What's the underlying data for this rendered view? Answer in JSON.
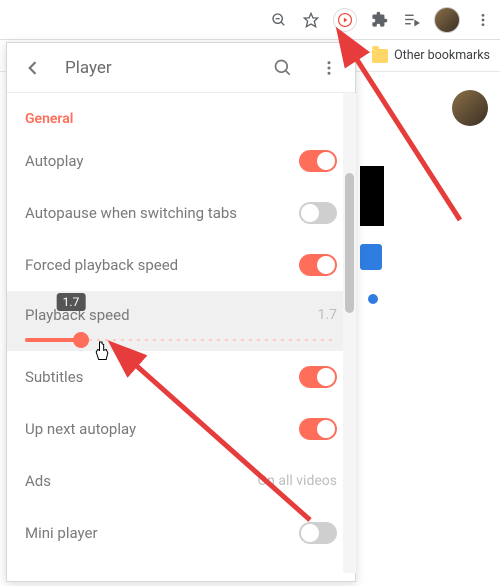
{
  "chrome": {
    "other_bookmarks": "Other bookmarks"
  },
  "panel": {
    "title": "Player",
    "section": "General",
    "items": {
      "autoplay": "Autoplay",
      "autopause": "Autopause when switching tabs",
      "forced_speed": "Forced playback speed",
      "playback_speed": "Playback speed",
      "subtitles": "Subtitles",
      "up_next": "Up next autoplay",
      "ads": "Ads",
      "ads_value": "On all videos",
      "mini": "Mini player"
    },
    "speed": {
      "value": "1.7",
      "tooltip": "1.7",
      "percent": 18
    },
    "states": {
      "autoplay": true,
      "autopause": false,
      "forced_speed": true,
      "subtitles": true,
      "up_next": true,
      "mini": false
    }
  }
}
